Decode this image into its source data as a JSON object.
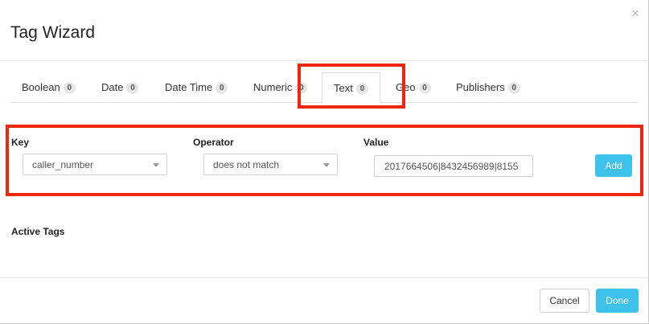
{
  "dialog": {
    "title": "Tag Wizard",
    "close_glyph": "×"
  },
  "tabs": [
    {
      "label": "Boolean",
      "count": "0"
    },
    {
      "label": "Date",
      "count": "0"
    },
    {
      "label": "Date Time",
      "count": "0"
    },
    {
      "label": "Numeric",
      "count": "0"
    },
    {
      "label": "Text",
      "count": "0",
      "active": true
    },
    {
      "label": "Geo",
      "count": "0"
    },
    {
      "label": "Publishers",
      "count": "0"
    }
  ],
  "form": {
    "key_label": "Key",
    "key_value": "caller_number",
    "operator_label": "Operator",
    "operator_value": "does not match",
    "value_label": "Value",
    "value_value": "2017664506|8432456989|8155",
    "add_label": "Add"
  },
  "active_tags_label": "Active Tags",
  "footer": {
    "cancel_label": "Cancel",
    "done_label": "Done"
  },
  "colors": {
    "accent": "#3ec1ea",
    "highlight": "#f2250d"
  }
}
